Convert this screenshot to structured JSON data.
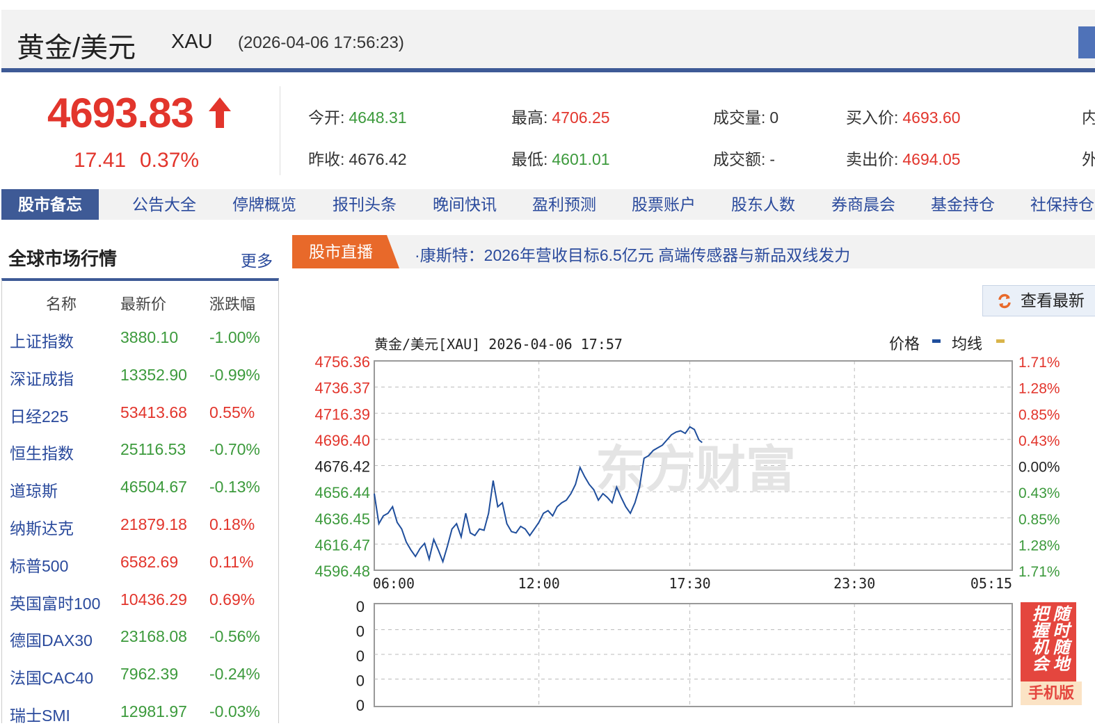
{
  "header": {
    "title": "黄金/美元",
    "code": "XAU",
    "datetime": "(2026-04-06 17:56:23)"
  },
  "quote": {
    "price": "4693.83",
    "change": "17.41",
    "change_pct": "0.37%",
    "direction": "up",
    "fields": [
      {
        "label": "今开:",
        "value": "4648.31",
        "color": "green"
      },
      {
        "label": "昨收:",
        "value": "4676.42",
        "color": "none"
      },
      {
        "label": "最高:",
        "value": "4706.25",
        "color": "red"
      },
      {
        "label": "最低:",
        "value": "4601.01",
        "color": "green"
      },
      {
        "label": "成交量:",
        "value": "0",
        "color": "none"
      },
      {
        "label": "成交额:",
        "value": "-",
        "color": "none"
      },
      {
        "label": "买入价:",
        "value": "4693.60",
        "color": "red"
      },
      {
        "label": "卖出价:",
        "value": "4694.05",
        "color": "red"
      },
      {
        "label": "内",
        "value": "",
        "color": "none"
      },
      {
        "label": "外",
        "value": "",
        "color": "none"
      }
    ]
  },
  "nav": {
    "items": [
      "股市备忘",
      "公告大全",
      "停牌概览",
      "报刊头条",
      "晚间快讯",
      "盈利预测",
      "股票账户",
      "股东人数",
      "券商晨会",
      "基金持仓",
      "社保持仓"
    ]
  },
  "sidebar": {
    "title": "全球市场行情",
    "more": "更多",
    "headers": [
      "名称",
      "最新价",
      "涨跌幅"
    ],
    "rows": [
      {
        "name": "上证指数",
        "price": "3880.10",
        "pct": "-1.00%",
        "dir": "down"
      },
      {
        "name": "深证成指",
        "price": "13352.90",
        "pct": "-0.99%",
        "dir": "down"
      },
      {
        "name": "日经225",
        "price": "53413.68",
        "pct": "0.55%",
        "dir": "up"
      },
      {
        "name": "恒生指数",
        "price": "25116.53",
        "pct": "-0.70%",
        "dir": "down"
      },
      {
        "name": "道琼斯",
        "price": "46504.67",
        "pct": "-0.13%",
        "dir": "down"
      },
      {
        "name": "纳斯达克",
        "price": "21879.18",
        "pct": "0.18%",
        "dir": "up"
      },
      {
        "name": "标普500",
        "price": "6582.69",
        "pct": "0.11%",
        "dir": "up"
      },
      {
        "name": "英国富时100",
        "price": "10436.29",
        "pct": "0.69%",
        "dir": "up"
      },
      {
        "name": "德国DAX30",
        "price": "23168.08",
        "pct": "-0.56%",
        "dir": "down"
      },
      {
        "name": "法国CAC40",
        "price": "7962.39",
        "pct": "-0.24%",
        "dir": "down"
      },
      {
        "name": "瑞士SMI",
        "price": "12981.97",
        "pct": "-0.03%",
        "dir": "down"
      }
    ]
  },
  "live": {
    "tag": "股市直播",
    "headline": "·康斯特：2026年营收目标6.5亿元 高端传感器与新品双线发力"
  },
  "refresh_label": "查看最新",
  "promo": {
    "text": "随时随地把握机会",
    "sub": "手机版"
  },
  "colors": {
    "up": "#e2352c",
    "down": "#3c9a3c",
    "line": "#1f4e9c",
    "avg": "#d9b44a",
    "brand": "#3e5a96"
  },
  "chart_data": {
    "type": "line",
    "title": "黄金/美元[XAU] 2026-04-06 17:57",
    "legend": [
      {
        "name": "价格",
        "color": "#1f4e9c"
      },
      {
        "name": "均线",
        "color": "#d9b44a"
      }
    ],
    "legend_position": "top-right",
    "prev_close": 4676.42,
    "ylim": [
      4596.48,
      4756.36
    ],
    "yticks": [
      "4756.36",
      "4736.37",
      "4716.39",
      "4696.40",
      "4676.42",
      "4656.44",
      "4636.45",
      "4616.47",
      "4596.48"
    ],
    "pct_ticks": [
      "1.71%",
      "1.28%",
      "0.85%",
      "0.43%",
      "0.00%",
      "0.43%",
      "0.85%",
      "1.28%",
      "1.71%"
    ],
    "xticks": [
      "06:00",
      "12:00",
      "17:30",
      "23:30",
      "05:15"
    ],
    "x_range_hours": [
      0,
      23.25
    ],
    "series": [
      {
        "name": "价格",
        "x_minutes_from_0600": [
          0,
          10,
          20,
          30,
          40,
          50,
          60,
          70,
          80,
          90,
          100,
          110,
          120,
          130,
          140,
          150,
          160,
          170,
          180,
          190,
          200,
          210,
          220,
          230,
          240,
          250,
          260,
          270,
          280,
          290,
          300,
          310,
          320,
          330,
          340,
          350,
          360,
          370,
          380,
          390,
          400,
          410,
          420,
          430,
          440,
          450,
          460,
          470,
          480,
          490,
          500,
          510,
          520,
          530,
          540,
          550,
          560,
          570,
          580,
          590,
          600,
          610,
          620,
          630,
          640,
          650,
          660,
          670,
          680,
          690,
          700,
          710,
          717
        ],
        "values": [
          4655,
          4632,
          4638,
          4640,
          4645,
          4633,
          4628,
          4618,
          4612,
          4607,
          4613,
          4617,
          4605,
          4620,
          4612,
          4603,
          4615,
          4628,
          4632,
          4622,
          4640,
          4625,
          4623,
          4628,
          4627,
          4640,
          4665,
          4645,
          4648,
          4632,
          4626,
          4625,
          4630,
          4628,
          4623,
          4628,
          4633,
          4640,
          4642,
          4638,
          4645,
          4648,
          4650,
          4655,
          4662,
          4675,
          4668,
          4662,
          4658,
          4650,
          4655,
          4652,
          4648,
          4660,
          4652,
          4645,
          4640,
          4648,
          4660,
          4682,
          4684,
          4688,
          4690,
          4692,
          4696,
          4700,
          4702,
          4703,
          4701,
          4706,
          4704,
          4696,
          4694
        ]
      }
    ],
    "volume": {
      "yticks": [
        "0",
        "0",
        "0",
        "0",
        "0"
      ]
    },
    "grid": true
  }
}
